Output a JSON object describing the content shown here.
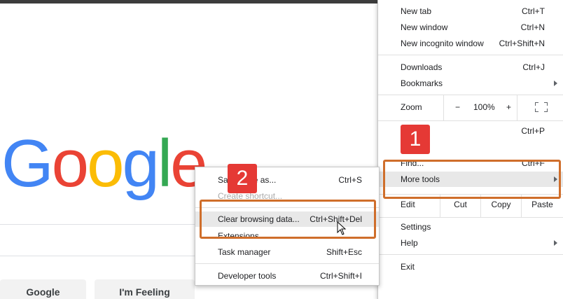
{
  "logo": {
    "letters": [
      "G",
      "o",
      "o",
      "g",
      "l",
      "e"
    ],
    "colors": [
      "#4285f4",
      "#ea4335",
      "#fbbc05",
      "#4285f4",
      "#34a853",
      "#ea4335"
    ]
  },
  "google_buttons": {
    "search": "Google Search",
    "lucky": "I'm Feeling Lucky"
  },
  "main_menu": {
    "new_tab": {
      "label": "New tab",
      "shortcut": "Ctrl+T"
    },
    "new_window": {
      "label": "New window",
      "shortcut": "Ctrl+N"
    },
    "new_incognito": {
      "label": "New incognito window",
      "shortcut": "Ctrl+Shift+N"
    },
    "downloads": {
      "label": "Downloads",
      "shortcut": "Ctrl+J"
    },
    "bookmarks": {
      "label": "Bookmarks"
    },
    "zoom": {
      "label": "Zoom",
      "minus": "−",
      "value": "100%",
      "plus": "+"
    },
    "print": {
      "shortcut": "Ctrl+P"
    },
    "find": {
      "label": "Find...",
      "shortcut": "Ctrl+F"
    },
    "more_tools": {
      "label": "More tools"
    },
    "edit": {
      "label": "Edit",
      "cut": "Cut",
      "copy": "Copy",
      "paste": "Paste"
    },
    "settings": {
      "label": "Settings"
    },
    "help": {
      "label": "Help"
    },
    "exit": {
      "label": "Exit"
    }
  },
  "sub_menu": {
    "save_page": {
      "label": "Save page as...",
      "shortcut": "Ctrl+S"
    },
    "create_shortcut": {
      "label": "Create shortcut..."
    },
    "clear_data": {
      "label": "Clear browsing data...",
      "shortcut": "Ctrl+Shift+Del"
    },
    "extensions": {
      "label": "Extensions"
    },
    "task_manager": {
      "label": "Task manager",
      "shortcut": "Shift+Esc"
    },
    "developer_tools": {
      "label": "Developer tools",
      "shortcut": "Ctrl+Shift+I"
    }
  },
  "annotations": {
    "badge1": "1",
    "badge2": "2",
    "badge_color": "#e53935",
    "outline_color": "#cf6e2b"
  }
}
